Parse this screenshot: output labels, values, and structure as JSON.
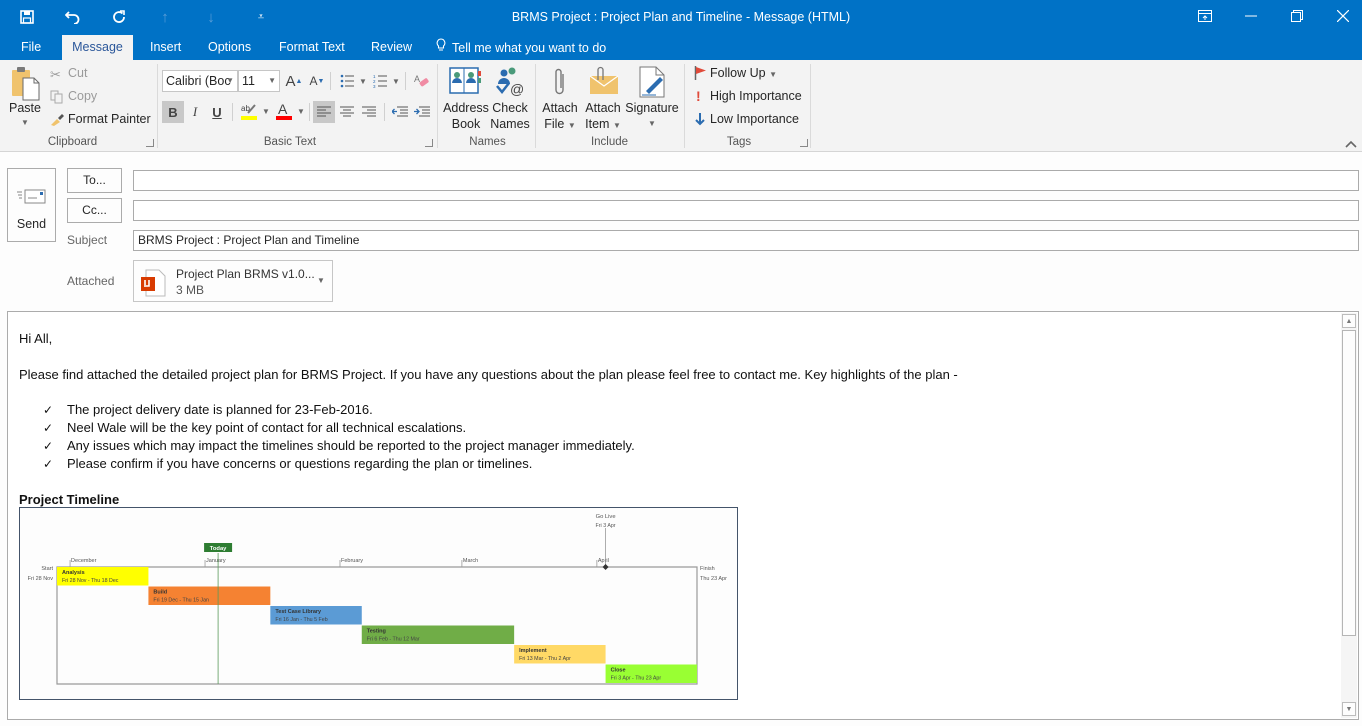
{
  "window": {
    "title": "BRMS Project : Project Plan and Timeline - Message (HTML)",
    "quick_access": [
      {
        "name": "save-icon",
        "glyph": "🖫"
      },
      {
        "name": "undo-icon",
        "glyph": "↶"
      },
      {
        "name": "redo-icon",
        "glyph": "↻"
      },
      {
        "name": "previous-item-icon",
        "glyph": "↑"
      },
      {
        "name": "next-item-icon",
        "glyph": "↓"
      },
      {
        "name": "customize-toolbar-icon",
        "glyph": "⩡"
      }
    ],
    "controls": {
      "ribbon_display": "ribbon-display-options",
      "minimize": "—",
      "restore": "❐",
      "close": "✕"
    }
  },
  "tabs": [
    {
      "label": "File",
      "active": false
    },
    {
      "label": "Message",
      "active": true
    },
    {
      "label": "Insert",
      "active": false
    },
    {
      "label": "Options",
      "active": false
    },
    {
      "label": "Format Text",
      "active": false
    },
    {
      "label": "Review",
      "active": false
    }
  ],
  "tell_me": "Tell me what you want to do",
  "ribbon": {
    "clipboard": {
      "label": "Clipboard",
      "paste": "Paste",
      "cut": "Cut",
      "copy": "Copy",
      "format_painter": "Format Painter"
    },
    "basic_text": {
      "label": "Basic Text",
      "font_name": "Calibri (Boc",
      "font_size": "11",
      "bold": "B",
      "italic": "I",
      "underline": "U",
      "highlight_color": "#ffff00",
      "font_color": "#ff0000"
    },
    "names": {
      "label": "Names",
      "address_book": [
        "Address",
        "Book"
      ],
      "check_names": [
        "Check",
        "Names"
      ]
    },
    "include": {
      "label": "Include",
      "attach_file": [
        "Attach",
        "File"
      ],
      "attach_item": [
        "Attach",
        "Item"
      ],
      "signature": "Signature"
    },
    "tags": {
      "label": "Tags",
      "follow_up": "Follow Up",
      "high_importance": "High Importance",
      "low_importance": "Low Importance"
    }
  },
  "compose": {
    "send": "Send",
    "to_button": "To...",
    "cc_button": "Cc...",
    "to_value": "",
    "cc_value": "",
    "subject_label": "Subject",
    "subject_value": "BRMS Project : Project Plan and Timeline",
    "attached_label": "Attached",
    "attachment": {
      "name": "Project Plan BRMS v1.0...",
      "size": "3 MB"
    }
  },
  "message": {
    "greeting": "Hi All,",
    "intro": "Please find attached the detailed project plan for BRMS Project. If you have any questions about the plan please feel free to contact me. Key highlights of the plan -",
    "bullet_glyph": "✓",
    "bullets": [
      "The project delivery date is planned for 23-Feb-2016.",
      "Neel Wale will be the key point of contact for all technical escalations.",
      "Any issues which may impact the timelines should be reported to the project manager immediately.",
      "Please confirm if you have concerns or questions regarding the plan or timelines."
    ],
    "timeline_heading": "Project Timeline"
  },
  "timeline": {
    "start": {
      "label": "Start",
      "date": "Fri 28 Nov"
    },
    "finish": {
      "label": "Finish",
      "date": "Thu 23 Apr"
    },
    "today_label": "Today",
    "today_day": 37,
    "range_days": 147,
    "months": [
      {
        "label": "December",
        "day": 3
      },
      {
        "label": "January",
        "day": 34
      },
      {
        "label": "February",
        "day": 65
      },
      {
        "label": "March",
        "day": 93
      },
      {
        "label": "April",
        "day": 124
      }
    ],
    "milestone": {
      "label": "Go Live",
      "date": "Fri 3 Apr",
      "day": 126
    },
    "tasks": [
      {
        "name": "Analysis",
        "dates": "Fri 28 Nov - Thu 18 Dec",
        "start": 0,
        "end": 21,
        "color": "#ffff00"
      },
      {
        "name": "Build",
        "dates": "Fri 19 Dec - Thu 15 Jan",
        "start": 21,
        "end": 49,
        "color": "#f58232"
      },
      {
        "name": "Test Case Library",
        "dates": "Fri 16 Jan - Thu 5 Feb",
        "start": 49,
        "end": 70,
        "color": "#5b9bd5"
      },
      {
        "name": "Testing",
        "dates": "Fri 6 Feb - Thu 12 Mar",
        "start": 70,
        "end": 105,
        "color": "#70ad47"
      },
      {
        "name": "Implement",
        "dates": "Fri 13 Mar - Thu 2 Apr",
        "start": 105,
        "end": 126,
        "color": "#ffd966"
      },
      {
        "name": "Close",
        "dates": "Fri 3 Apr - Thu 23 Apr",
        "start": 126,
        "end": 147,
        "color": "#99ff33"
      }
    ]
  },
  "colors": {
    "titlebar": "#0072c6",
    "ribbon": "#f3f3f3",
    "today_marker": "#2e7d32"
  }
}
